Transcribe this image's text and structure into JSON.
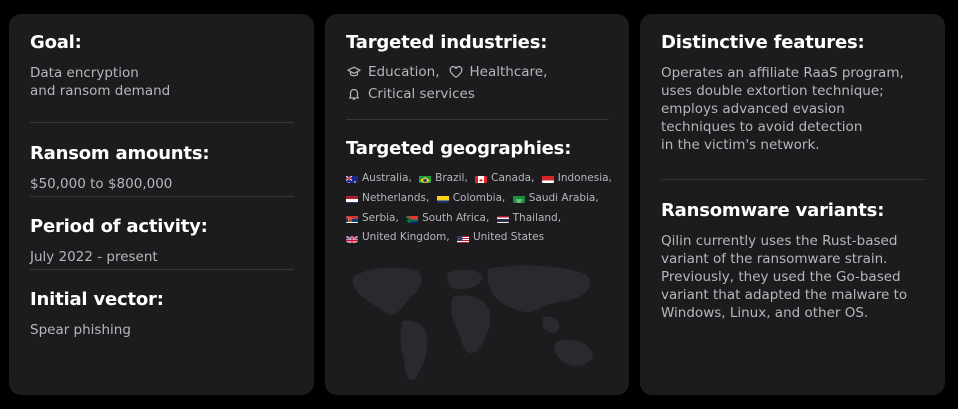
{
  "card1": {
    "goal": {
      "title": "Goal:",
      "lines": [
        "Data encryption",
        "and ransom demand"
      ]
    },
    "ransom": {
      "title": "Ransom amounts:",
      "value": "$50,000 to $800,000"
    },
    "period": {
      "title": "Period of activity:",
      "value": "July 2022 - present"
    },
    "vector": {
      "title": "Initial vector:",
      "value": "Spear phishing"
    }
  },
  "card2": {
    "industries": {
      "title": "Targeted industries:",
      "items": [
        {
          "icon": "graduation-cap-icon",
          "label": "Education,"
        },
        {
          "icon": "heart-icon",
          "label": "Healthcare,"
        },
        {
          "icon": "bell-icon",
          "label": "Critical services"
        }
      ]
    },
    "geographies": {
      "title": "Targeted geographies:",
      "countries": [
        {
          "name": "Australia,",
          "flag": "australia-flag-icon"
        },
        {
          "name": "Brazil,",
          "flag": "brazil-flag-icon"
        },
        {
          "name": "Canada,",
          "flag": "canada-flag-icon"
        },
        {
          "name": "Indonesia,",
          "flag": "indonesia-flag-icon"
        },
        {
          "name": "Netherlands,",
          "flag": "netherlands-flag-icon"
        },
        {
          "name": "Colombia,",
          "flag": "colombia-flag-icon"
        },
        {
          "name": "Saudi Arabia,",
          "flag": "saudi-arabia-flag-icon"
        },
        {
          "name": "Serbia,",
          "flag": "serbia-flag-icon"
        },
        {
          "name": "South Africa,",
          "flag": "south-africa-flag-icon"
        },
        {
          "name": "Thailand,",
          "flag": "thailand-flag-icon"
        },
        {
          "name": "United Kingdom,",
          "flag": "united-kingdom-flag-icon"
        },
        {
          "name": "United States",
          "flag": "united-states-flag-icon"
        }
      ]
    }
  },
  "card3": {
    "features": {
      "title": "Distinctive features:",
      "lines": [
        "Operates an affiliate RaaS program,",
        "uses double extortion technique;",
        "employs advanced evasion",
        "techniques to avoid detection",
        "in the victim's network."
      ]
    },
    "variants": {
      "title": "Ransomware variants:",
      "lines": [
        "Qilin currently uses the Rust-based",
        "variant of the ransomware strain.",
        "Previously, they used the Go-based",
        "variant that adapted the malware to",
        "Windows, Linux, and other OS."
      ]
    }
  },
  "colors": {
    "card": "#1c1c1f",
    "background": "#000000",
    "text": "#ffffff",
    "muted": "#b7b7bb",
    "divider": "#35353a"
  }
}
